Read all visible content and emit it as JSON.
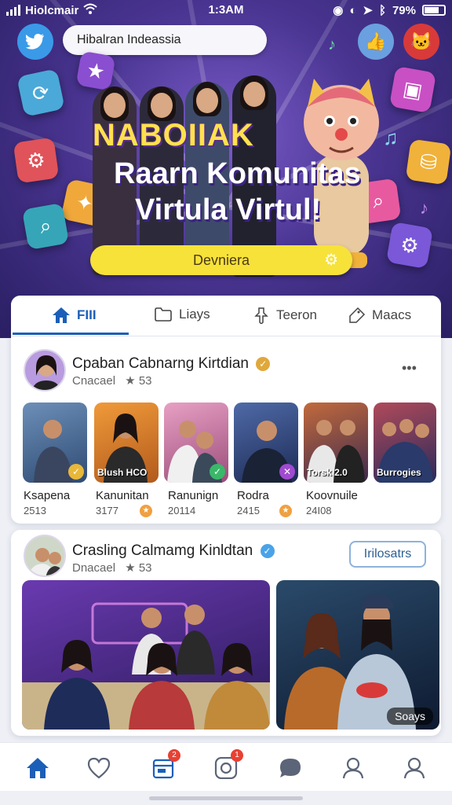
{
  "status_bar": {
    "carrier": "Hiolcmair",
    "time": "1:3AM",
    "battery": "79%"
  },
  "header": {
    "search_text": "Hibalran Indeassia"
  },
  "hero": {
    "title_line1": "NABOIIAK",
    "title_line2": "Raarn Komunitas",
    "title_line3": "Virtula Virtul!",
    "cta_label": "Devniera"
  },
  "tabs": [
    {
      "label": "FIII",
      "icon": "home-icon"
    },
    {
      "label": "Liays",
      "icon": "folder-icon"
    },
    {
      "label": "Teeron",
      "icon": "pin-icon"
    },
    {
      "label": "Maacs",
      "icon": "tag-icon"
    }
  ],
  "post1": {
    "title": "Cpaban Cabnarng Kirtdian",
    "subtitle": "Cnacael",
    "rating": "53",
    "more": "•••",
    "tiles": [
      {
        "name": "Ksapena",
        "num": "2513",
        "tag": "",
        "colors": [
          "#6c8fb8",
          "#2f4b73"
        ]
      },
      {
        "name": "Kanunitan",
        "num": "3177",
        "tag": "Blush HCO",
        "colors": [
          "#f09a3a",
          "#b25a1c"
        ]
      },
      {
        "name": "Ranunign",
        "num": "20114",
        "tag": "",
        "colors": [
          "#e8a0c4",
          "#9a4d7a"
        ]
      },
      {
        "name": "Rodra",
        "num": "2415",
        "tag": "",
        "colors": [
          "#4f6aa8",
          "#1d2b55"
        ]
      },
      {
        "name": "Koovnuile",
        "num": "24I08",
        "tag": "Torsk 2.0",
        "colors": [
          "#c26a3c",
          "#3d2a4f"
        ]
      },
      {
        "name": "",
        "num": "",
        "tag": "Burrogies",
        "colors": [
          "#b04a5a",
          "#2a2a5a"
        ]
      }
    ]
  },
  "post2": {
    "title": "Crasling Calmamg Kinldtan",
    "subtitle": "Dnacael",
    "rating": "53",
    "follow_label": "Irilosatrs",
    "photo_tag": "Soays"
  },
  "bottom_nav": [
    {
      "icon": "home-icon"
    },
    {
      "icon": "heart-icon"
    },
    {
      "icon": "calendar-icon",
      "badge": "2"
    },
    {
      "icon": "instagram-icon",
      "badge": "1"
    },
    {
      "icon": "chat-icon"
    },
    {
      "icon": "person-icon"
    },
    {
      "icon": "profile-icon"
    }
  ],
  "colors": {
    "accent": "#1c5fb8",
    "cta": "#f7e23a",
    "hero_bg": "#4a3592",
    "verified_gold": "#e0a83a",
    "verified_blue": "#4aa3e8"
  }
}
